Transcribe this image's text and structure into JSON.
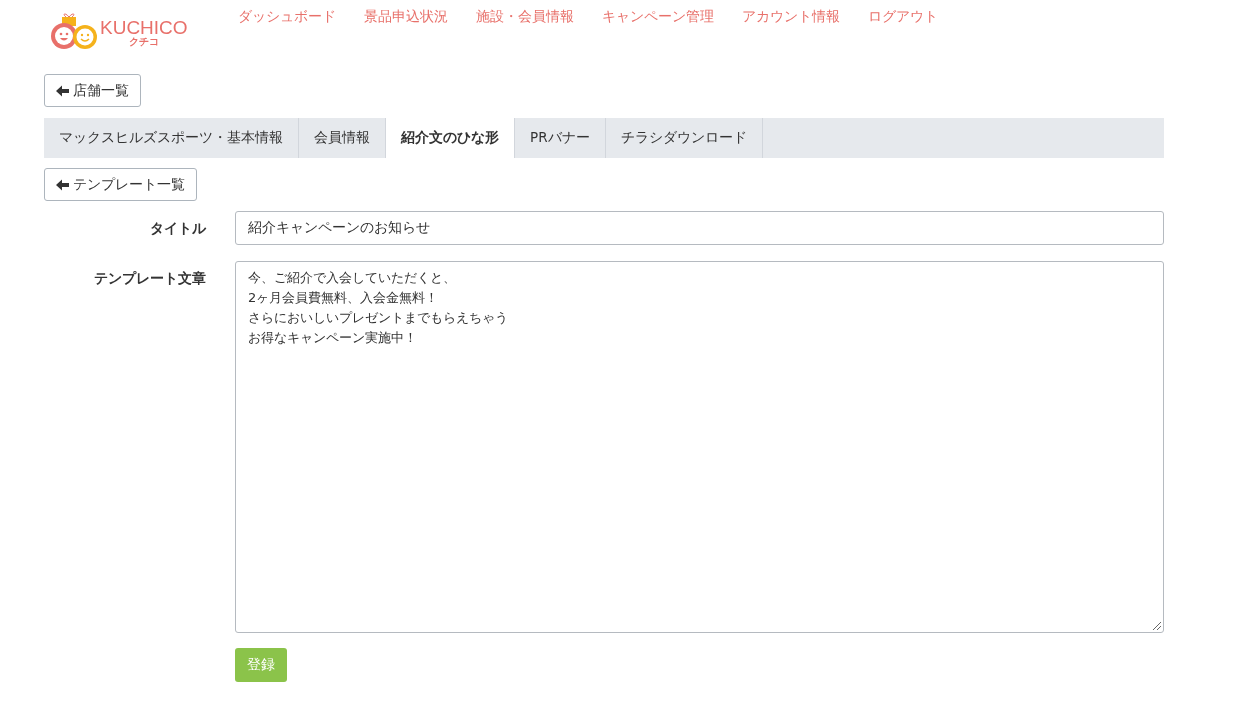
{
  "logo": {
    "name": "KUCHICO",
    "kana": "クチコ"
  },
  "nav": [
    "ダッシュボード",
    "景品申込状況",
    "施設・会員情報",
    "キャンペーン管理",
    "アカウント情報",
    "ログアウト"
  ],
  "back_button": "店舗一覧",
  "tabs": [
    {
      "label": "マックスヒルズスポーツ・基本情報",
      "selected": false
    },
    {
      "label": "会員情報",
      "selected": false
    },
    {
      "label": "紹介文のひな形",
      "selected": true
    },
    {
      "label": "PRバナー",
      "selected": false
    },
    {
      "label": "チラシダウンロード",
      "selected": false
    }
  ],
  "template_back_button": "テンプレート一覧",
  "form": {
    "title_label": "タイトル",
    "title_value": "紹介キャンペーンのお知らせ",
    "body_label": "テンプレート文章",
    "body_lines": [
      "今、ご紹介で入会していただくと、",
      "2ヶ月会員費無料、入会金無料！",
      "さらにおいしいプレゼントまでもらえちゃう",
      "お得なキャンペーン実施中！"
    ],
    "submit": "登録"
  }
}
